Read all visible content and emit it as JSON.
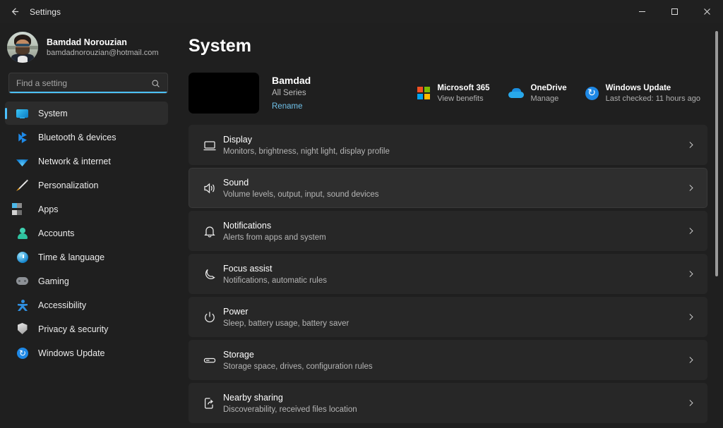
{
  "window": {
    "app_title": "Settings",
    "back_icon": "back-arrow-icon",
    "minimize_label": "–",
    "maximize_label": "□",
    "close_label": "✕"
  },
  "sidebar": {
    "account": {
      "name": "Bamdad Norouzian",
      "email": "bamdadnorouzian@hotmail.com",
      "avatar_icon": "user-avatar-photo"
    },
    "search": {
      "placeholder": "Find a setting",
      "value": "",
      "icon": "search-icon"
    },
    "items": [
      {
        "label": "System",
        "icon": "monitor-icon",
        "active": true
      },
      {
        "label": "Bluetooth & devices",
        "icon": "bluetooth-icon",
        "active": false
      },
      {
        "label": "Network & internet",
        "icon": "wifi-icon",
        "active": false
      },
      {
        "label": "Personalization",
        "icon": "paintbrush-icon",
        "active": false
      },
      {
        "label": "Apps",
        "icon": "apps-grid-icon",
        "active": false
      },
      {
        "label": "Accounts",
        "icon": "person-icon",
        "active": false
      },
      {
        "label": "Time & language",
        "icon": "clock-icon",
        "active": false
      },
      {
        "label": "Gaming",
        "icon": "gamepad-icon",
        "active": false
      },
      {
        "label": "Accessibility",
        "icon": "accessibility-icon",
        "active": false
      },
      {
        "label": "Privacy & security",
        "icon": "shield-icon",
        "active": false
      },
      {
        "label": "Windows Update",
        "icon": "update-refresh-icon",
        "active": false
      }
    ]
  },
  "main": {
    "page_title": "System",
    "device": {
      "name": "Bamdad",
      "model": "All Series",
      "rename_label": "Rename",
      "thumb_icon": "device-thumbnail"
    },
    "quick_links": [
      {
        "title": "Microsoft 365",
        "subtitle": "View benefits",
        "icon": "microsoft-logo-icon"
      },
      {
        "title": "OneDrive",
        "subtitle": "Manage",
        "icon": "onedrive-cloud-icon"
      },
      {
        "title": "Windows Update",
        "subtitle": "Last checked: 11 hours ago",
        "icon": "update-refresh-icon"
      }
    ],
    "rows": [
      {
        "title": "Display",
        "subtitle": "Monitors, brightness, night light, display profile",
        "icon": "monitor-icon",
        "hover": false
      },
      {
        "title": "Sound",
        "subtitle": "Volume levels, output, input, sound devices",
        "icon": "speaker-icon",
        "hover": true
      },
      {
        "title": "Notifications",
        "subtitle": "Alerts from apps and system",
        "icon": "bell-icon",
        "hover": false
      },
      {
        "title": "Focus assist",
        "subtitle": "Notifications, automatic rules",
        "icon": "moon-icon",
        "hover": false
      },
      {
        "title": "Power",
        "subtitle": "Sleep, battery usage, battery saver",
        "icon": "power-icon",
        "hover": false
      },
      {
        "title": "Storage",
        "subtitle": "Storage space, drives, configuration rules",
        "icon": "drive-icon",
        "hover": false
      },
      {
        "title": "Nearby sharing",
        "subtitle": "Discoverability, received files location",
        "icon": "nearby-share-icon",
        "hover": false
      }
    ],
    "chevron_icon": "chevron-right-icon",
    "scrollbar": "vertical-scrollbar"
  },
  "colors": {
    "accent": "#4cc2ff",
    "window_bg": "#1f1f1f",
    "card_bg": "#272727",
    "link": "#6fc0e8"
  }
}
